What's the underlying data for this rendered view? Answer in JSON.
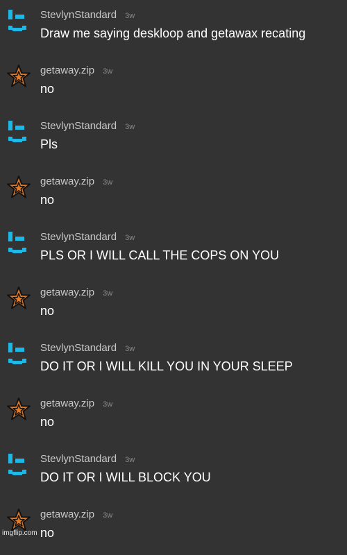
{
  "accent_color": "#1fb7e6",
  "star_color": "#e07b2a",
  "messages": [
    {
      "user": "StevlynStandard",
      "avatar": "smiley-face-icon",
      "time": "3w",
      "text": "Draw me saying deskloop and getawax recating"
    },
    {
      "user": "getaway.zip",
      "avatar": "star-icon",
      "time": "3w",
      "text": "no"
    },
    {
      "user": "StevlynStandard",
      "avatar": "smiley-face-icon",
      "time": "3w",
      "text": "Pls"
    },
    {
      "user": "getaway.zip",
      "avatar": "star-icon",
      "time": "3w",
      "text": "no"
    },
    {
      "user": "StevlynStandard",
      "avatar": "smiley-face-icon",
      "time": "3w",
      "text": "PLS OR I WILL CALL THE COPS ON YOU"
    },
    {
      "user": "getaway.zip",
      "avatar": "star-icon",
      "time": "3w",
      "text": "no"
    },
    {
      "user": "StevlynStandard",
      "avatar": "smiley-face-icon",
      "time": "3w",
      "text": "DO IT OR I WILL KILL YOU IN YOUR SLEEP"
    },
    {
      "user": "getaway.zip",
      "avatar": "star-icon",
      "time": "3w",
      "text": "no"
    },
    {
      "user": "StevlynStandard",
      "avatar": "smiley-face-icon",
      "time": "3w",
      "text": "DO IT OR I WILL BLOCK YOU"
    },
    {
      "user": "getaway.zip",
      "avatar": "star-icon",
      "time": "3w",
      "text": "no"
    }
  ],
  "watermark": "imgflip.com"
}
